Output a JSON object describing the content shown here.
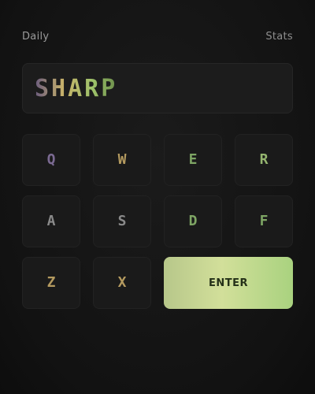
{
  "header": {
    "left_label": "Daily",
    "right_label": "Stats"
  },
  "display": {
    "value": "SHARP"
  },
  "keys": [
    {
      "label": "Q",
      "sub": "",
      "tone": "purple"
    },
    {
      "label": "W",
      "sub": "",
      "tone": "amber"
    },
    {
      "label": "E",
      "sub": "",
      "tone": "green"
    },
    {
      "label": "R",
      "sub": "",
      "tone": "lime"
    },
    {
      "label": "A",
      "sub": "",
      "tone": "none"
    },
    {
      "label": "S",
      "sub": "",
      "tone": "none"
    },
    {
      "label": "D",
      "sub": "",
      "tone": "green"
    },
    {
      "label": "F",
      "sub": "",
      "tone": "green"
    },
    {
      "label": "Z",
      "sub": "",
      "tone": "amber"
    },
    {
      "label": "X",
      "sub": "",
      "tone": "amber"
    }
  ],
  "submit": {
    "label": "ENTER"
  },
  "colors": {
    "accent_purple": "#7b6a92",
    "accent_amber": "#b49a5f",
    "accent_green": "#7ea564",
    "accent_lime": "#95b56f",
    "background": "#141414"
  }
}
